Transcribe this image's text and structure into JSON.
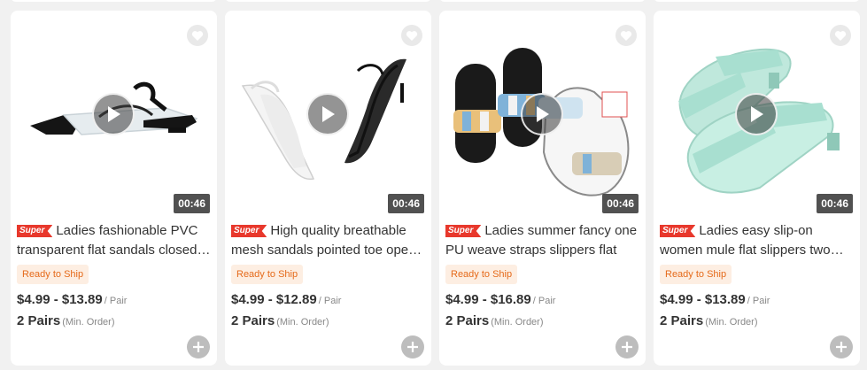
{
  "products": [
    {
      "badge": "Super",
      "title": "Ladies fashionable PVC transparent flat sandals closed-toe",
      "shipping_tag": "Ready to Ship",
      "price_range": "$4.99 - $13.89",
      "price_unit": "/ Pair",
      "min_order": "2 Pairs",
      "min_order_note": "(Min. Order)",
      "video_duration": "00:46",
      "image_icon": "black-pvc-flat-sandal-image"
    },
    {
      "badge": "Super",
      "title": "High quality breathable mesh sandals pointed toe open-back",
      "shipping_tag": "Ready to Ship",
      "price_range": "$4.99 - $12.89",
      "price_unit": "/ Pair",
      "min_order": "2 Pairs",
      "min_order_note": "(Min. Order)",
      "video_duration": "00:46",
      "image_icon": "mesh-pointed-sandal-image"
    },
    {
      "badge": "Super",
      "title": "Ladies summer fancy one PU weave straps slippers flat",
      "shipping_tag": "Ready to Ship",
      "price_range": "$4.99 - $16.89",
      "price_unit": "/ Pair",
      "min_order": "2 Pairs",
      "min_order_note": "(Min. Order)",
      "video_duration": "00:46",
      "image_icon": "woven-strap-slipper-image"
    },
    {
      "badge": "Super",
      "title": "Ladies easy slip-on women mule flat slippers two straps",
      "shipping_tag": "Ready to Ship",
      "price_range": "$4.99 - $13.89",
      "price_unit": "/ Pair",
      "min_order": "2 Pairs",
      "min_order_note": "(Min. Order)",
      "video_duration": "00:46",
      "image_icon": "mint-mule-slipper-image"
    }
  ],
  "colors": {
    "accent": "#e8382c",
    "ready_text": "#e56a1a",
    "ready_bg": "#fdeee2"
  }
}
